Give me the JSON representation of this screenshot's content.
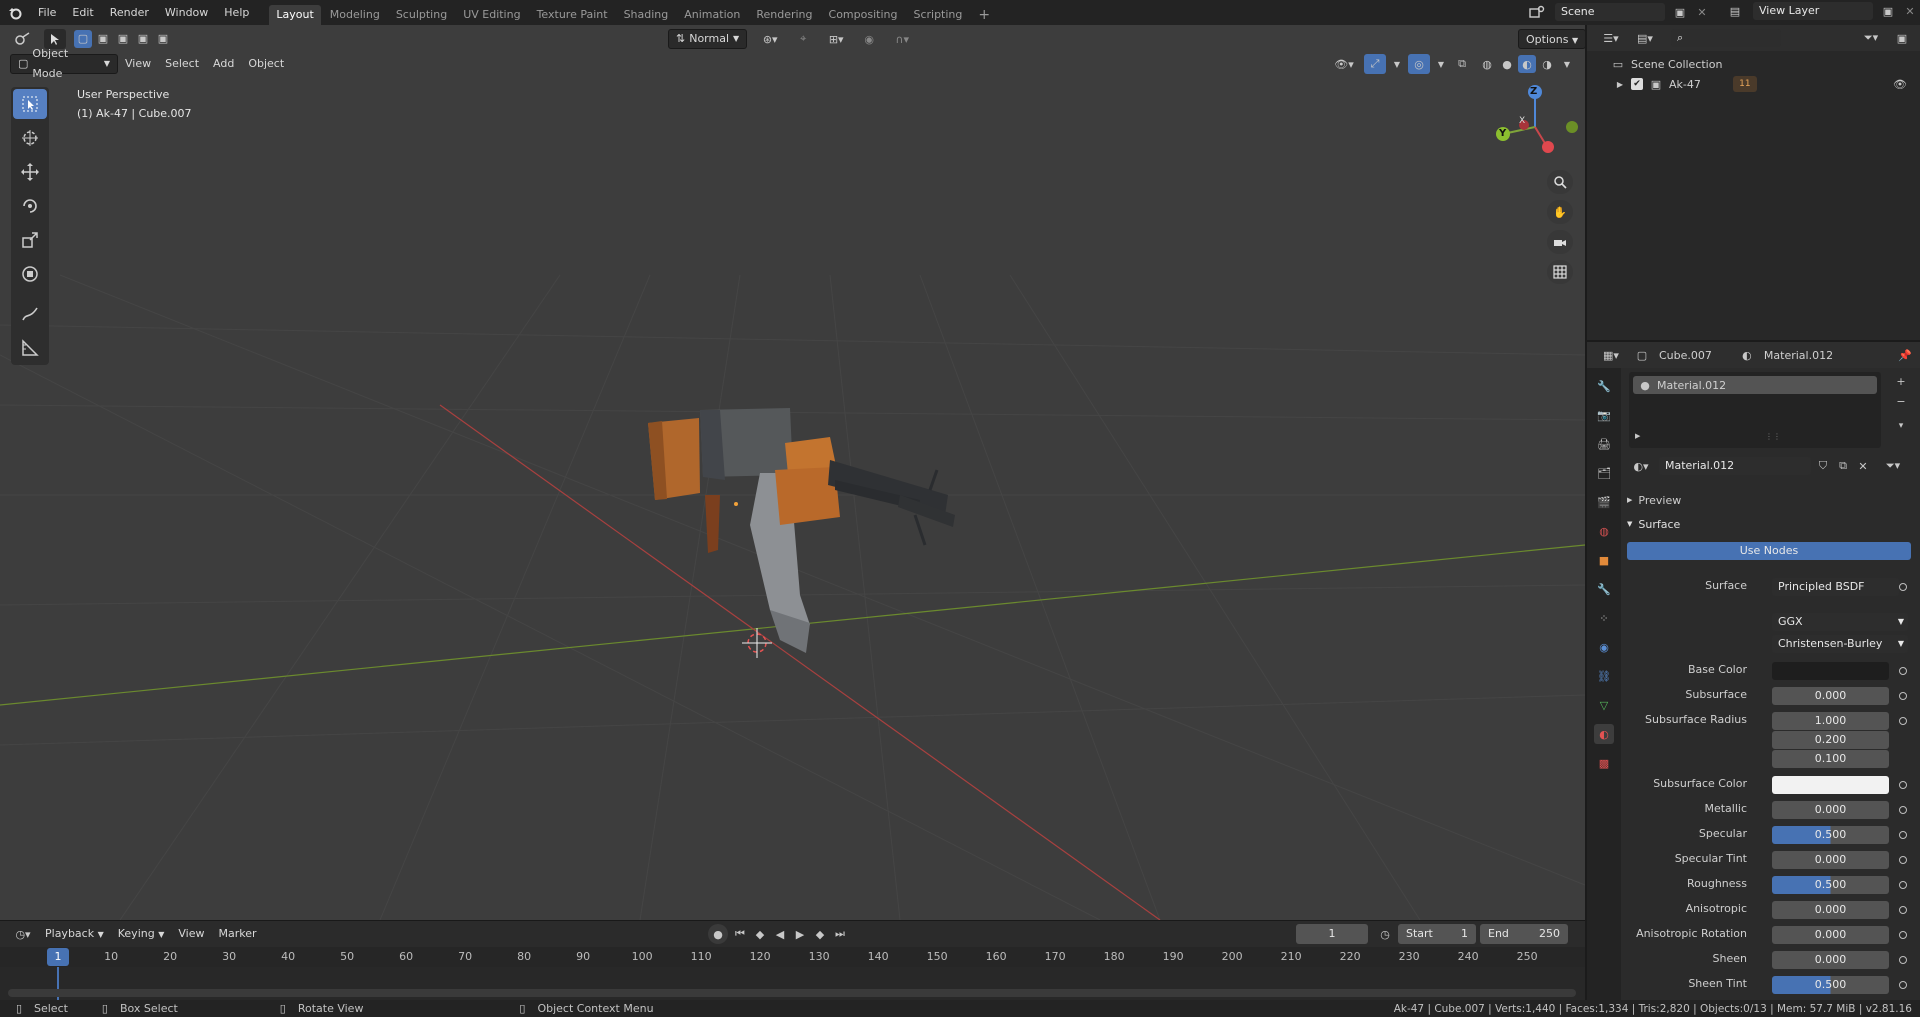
{
  "topbar": {
    "menus": [
      "File",
      "Edit",
      "Render",
      "Window",
      "Help"
    ],
    "workspaces": [
      "Layout",
      "Modeling",
      "Sculpting",
      "UV Editing",
      "Texture Paint",
      "Shading",
      "Animation",
      "Rendering",
      "Compositing",
      "Scripting"
    ],
    "active_workspace": "Layout",
    "scene": "Scene",
    "view_layer": "View Layer"
  },
  "viewport": {
    "mode": "Object Mode",
    "menus": [
      "View",
      "Select",
      "Add",
      "Object"
    ],
    "orientation": "Normal",
    "options": "Options",
    "perspective_label": "User Perspective",
    "object_label": "(1) Ak-47 | Cube.007",
    "gizmo_axes": [
      "Z",
      "Y",
      "X"
    ]
  },
  "timeline": {
    "menus": [
      "Playback",
      "Keying",
      "View",
      "Marker"
    ],
    "current_frame": "1",
    "start_label": "Start",
    "start": "1",
    "end_label": "End",
    "end": "250",
    "ticks": [
      "1",
      "10",
      "20",
      "30",
      "40",
      "50",
      "60",
      "70",
      "80",
      "90",
      "100",
      "110",
      "120",
      "130",
      "140",
      "150",
      "160",
      "170",
      "180",
      "190",
      "200",
      "210",
      "220",
      "230",
      "240",
      "250"
    ]
  },
  "status": {
    "select": "Select",
    "box_select": "Box Select",
    "rotate_view": "Rotate View",
    "context_menu": "Object Context Menu",
    "info": "Ak-47 | Cube.007 | Verts:1,440 | Faces:1,334 | Tris:2,820 | Objects:0/13 | Mem: 57.7 MiB | v2.81.16"
  },
  "outliner": {
    "root": "Scene Collection",
    "item": "Ak-47",
    "badge": "11"
  },
  "properties": {
    "object": "Cube.007",
    "material_header": "Material.012",
    "slot": "Material.012",
    "material_name": "Material.012",
    "preview": "Preview",
    "surface_panel": "Surface",
    "use_nodes": "Use Nodes",
    "surface_label": "Surface",
    "surface_value": "Principled BSDF",
    "distribution": "GGX",
    "subsurface_method": "Christensen-Burley",
    "base_color_label": "Base Color",
    "rows": [
      {
        "label": "Subsurface",
        "value": "0.000",
        "fill": 0
      },
      {
        "label": "Metallic",
        "value": "0.000",
        "fill": 0
      },
      {
        "label": "Specular",
        "value": "0.500",
        "fill": 0.5
      },
      {
        "label": "Specular Tint",
        "value": "0.000",
        "fill": 0
      },
      {
        "label": "Roughness",
        "value": "0.500",
        "fill": 0.5
      },
      {
        "label": "Anisotropic",
        "value": "0.000",
        "fill": 0
      },
      {
        "label": "Anisotropic Rotation",
        "value": "0.000",
        "fill": 0
      },
      {
        "label": "Sheen",
        "value": "0.000",
        "fill": 0
      },
      {
        "label": "Sheen Tint",
        "value": "0.500",
        "fill": 0.5
      }
    ],
    "subsurface_radius_label": "Subsurface Radius",
    "subsurface_radius": [
      "1.000",
      "0.200",
      "0.100"
    ],
    "subsurface_color_label": "Subsurface Color"
  },
  "colors": {
    "accent": "#5680c2",
    "use_nodes": "#4772b3",
    "x_axis": "#c9474b",
    "y_axis": "#7fa43a",
    "z_axis": "#4f88d8"
  }
}
